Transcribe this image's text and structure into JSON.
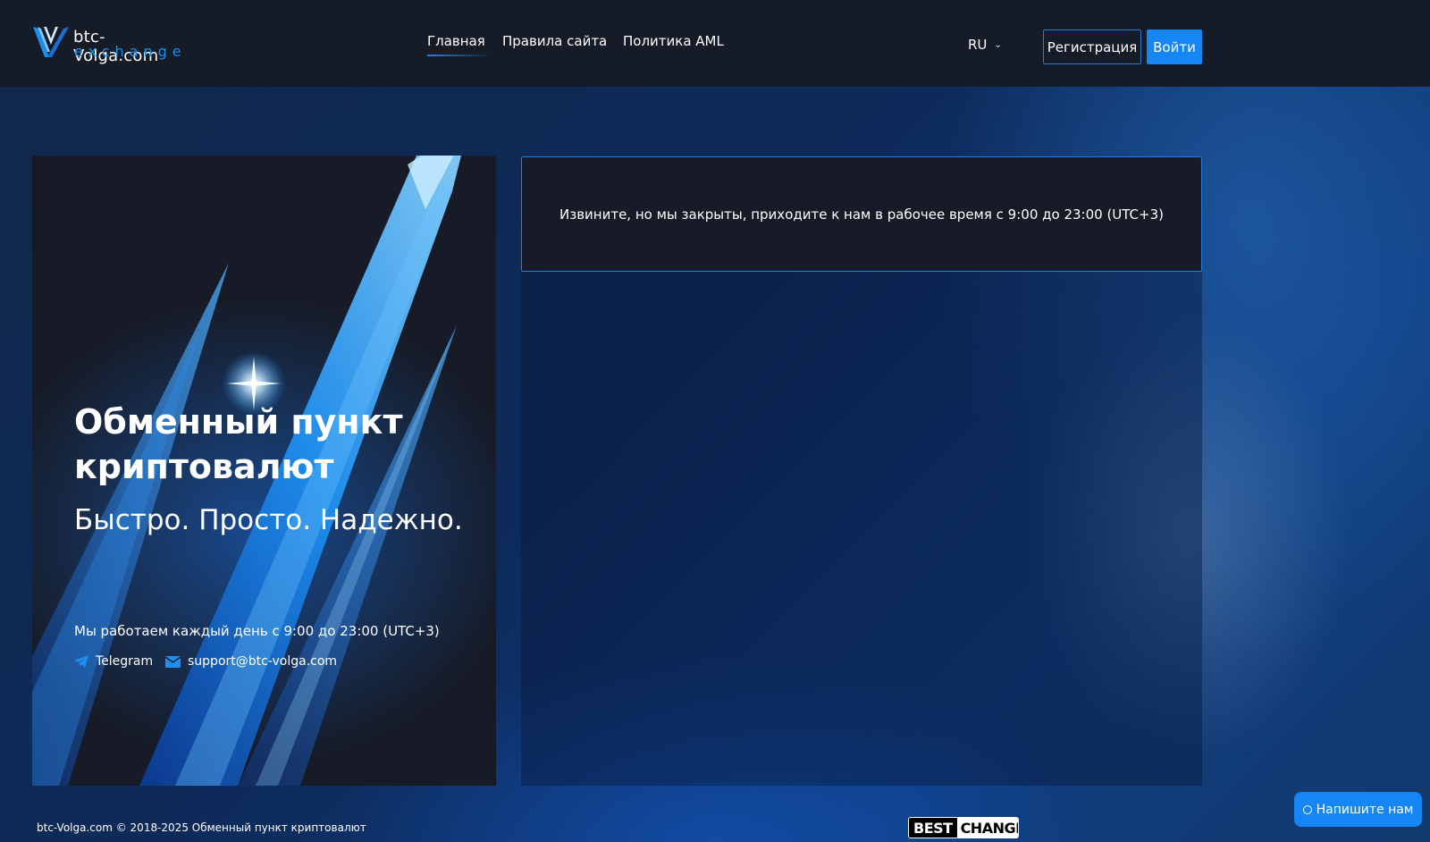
{
  "header": {
    "logo": {
      "name": "btc-Volga.com",
      "sub": "exchange",
      "icon": "v-logo-icon"
    },
    "nav": [
      {
        "label": "Главная",
        "active": true
      },
      {
        "label": "Правила сайта",
        "active": false
      },
      {
        "label": "Политика AML",
        "active": false
      }
    ],
    "language": {
      "selected": "RU",
      "icon": "chevron-down-icon"
    },
    "register_label": "Регистрация",
    "login_label": "Войти"
  },
  "hero": {
    "title": "Обменный пункт криптовалют",
    "subtitle": "Быстро. Просто. Надежно.",
    "hours": "Мы работаем каждый день с 9:00 до 23:00 (UTC+3)",
    "contacts": [
      {
        "label": "Telegram",
        "icon": "telegram-icon"
      },
      {
        "label": "support@btc-volga.com",
        "icon": "mail-icon"
      }
    ]
  },
  "notice": {
    "text": "Извините, но мы закрыты, приходите к нам в рабочее время с 9:00 до 23:00 (UTC+3)"
  },
  "footer": {
    "copyright": "btc-Volga.com © 2018-2025 Обменный пункт криптовалют",
    "bestchange": {
      "part1": "BEST",
      "part2": "CHANGE"
    },
    "chat_label": "Напишите нам"
  },
  "colors": {
    "accent": "#1686f5",
    "header_bg": "#151b27",
    "card_bg": "#161b27",
    "border": "#2a7de0"
  }
}
